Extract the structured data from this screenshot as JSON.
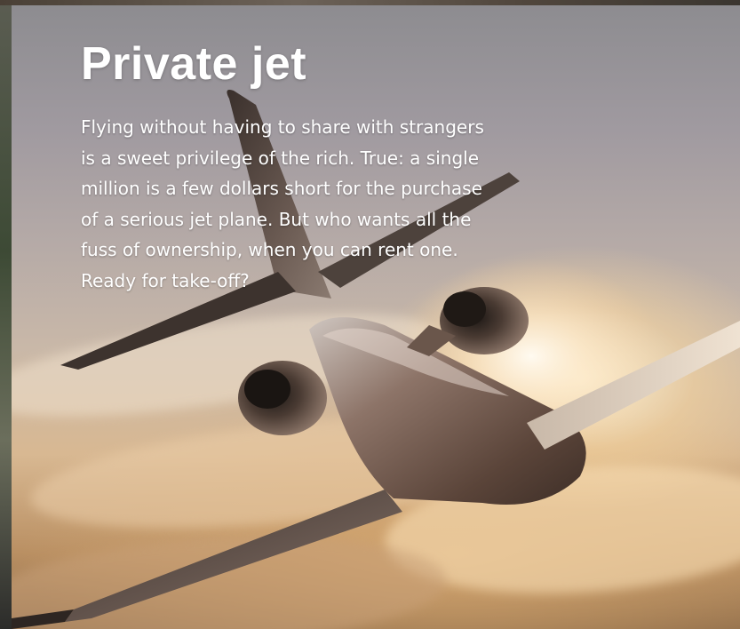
{
  "card": {
    "title": "Private jet",
    "body": "Flying without having to share with strangers\nis a sweet privilege of the rich. True: a single\nmillion is a few dollars short for the purchase\nof a serious jet plane. But who wants all the\nfuss of ownership, when you can rent one.\nReady for take-off?"
  },
  "image": {
    "subject": "business-jet-icon"
  },
  "colors": {
    "text": "#ffffff",
    "sky_top": "#8d8c90",
    "sky_glow": "#f7d6a0",
    "fuselage": "#6e5548"
  }
}
